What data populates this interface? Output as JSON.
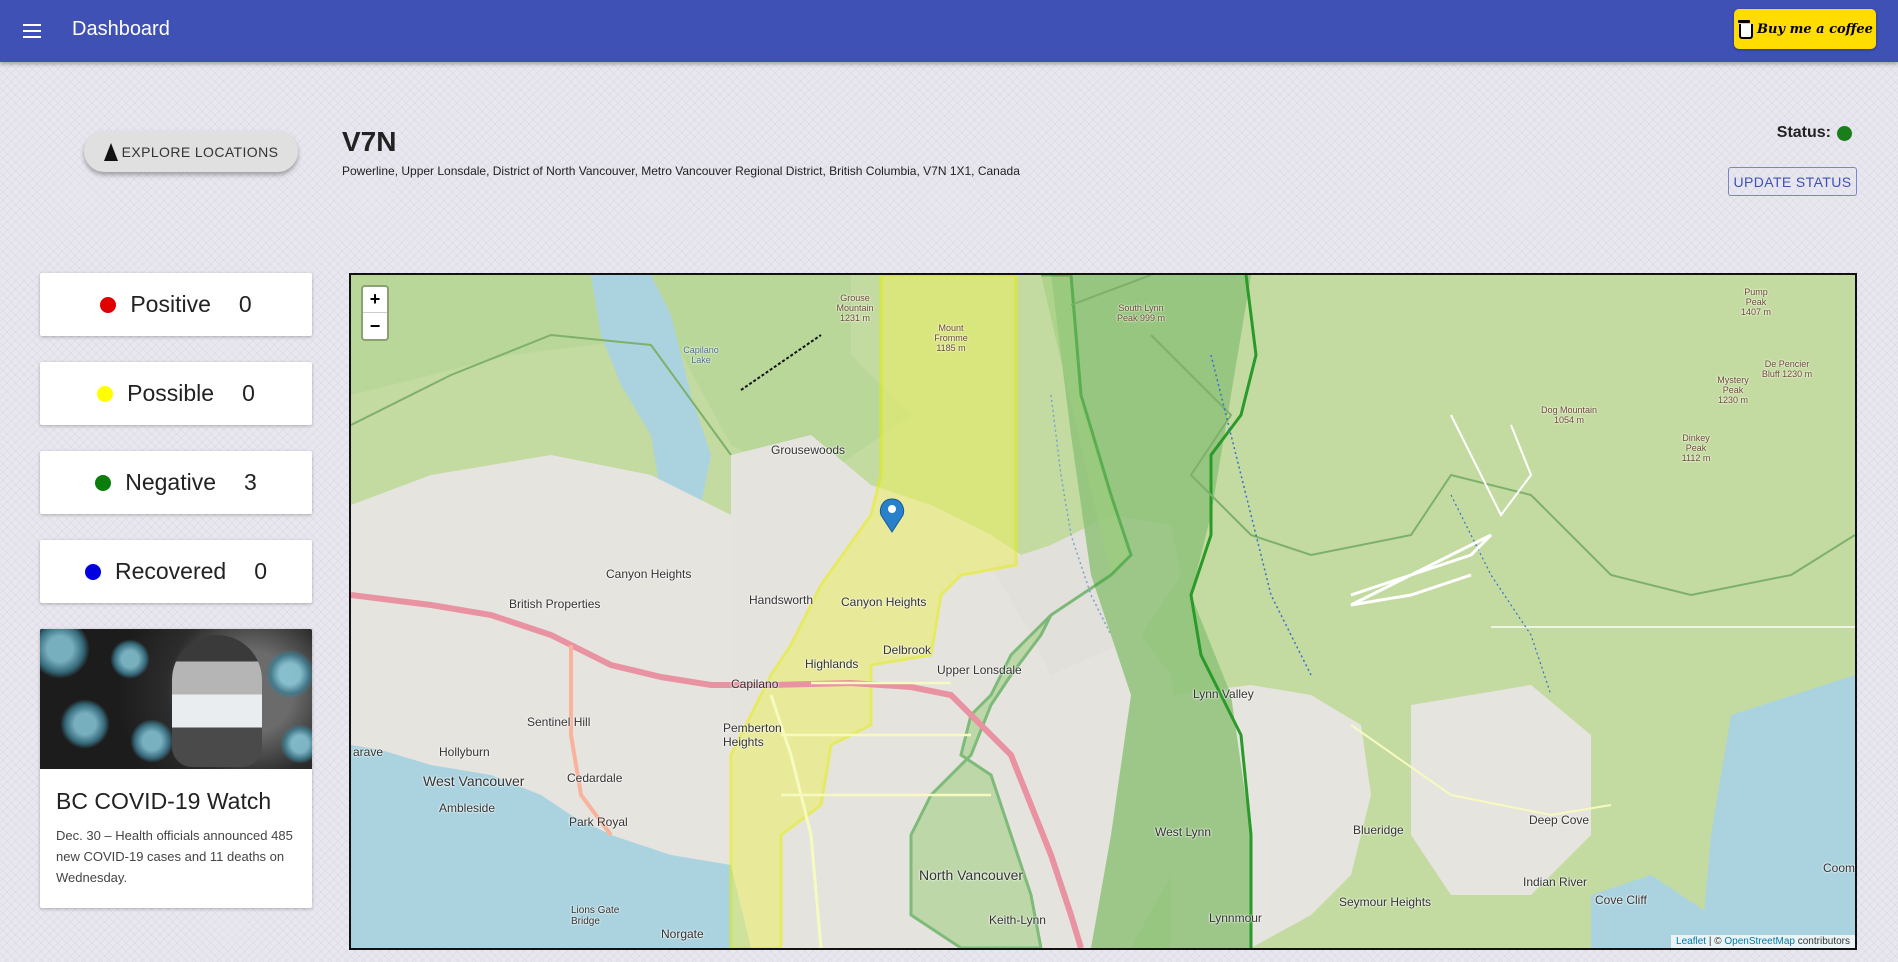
{
  "appbar": {
    "title": "Dashboard",
    "coffee_label": "Buy me a coffee"
  },
  "explore_label": "EXPLORE LOCATIONS",
  "location": {
    "postal": "V7N",
    "address": "Powerline, Upper Lonsdale, District of North Vancouver, Metro Vancouver Regional District, British Columbia, V7N 1X1, Canada"
  },
  "status": {
    "label": "Status:",
    "color": "#1a7f1a",
    "update_label": "UPDATE STATUS"
  },
  "stats": [
    {
      "label": "Positive",
      "count": "0",
      "color": "#e00000"
    },
    {
      "label": "Possible",
      "count": "0",
      "color": "#ffff00"
    },
    {
      "label": "Negative",
      "count": "3",
      "color": "#0a7d0a"
    },
    {
      "label": "Recovered",
      "count": "0",
      "color": "#0000e0"
    }
  ],
  "news": {
    "title": "BC COVID-19 Watch",
    "text": "Dec. 30 – Health officials announced 485 new COVID-19 cases and 11 deaths on Wednesday."
  },
  "map": {
    "zoom_in": "+",
    "zoom_out": "−",
    "attribution_leaflet": "Leaflet",
    "attribution_sep": " | © ",
    "attribution_osm": "OpenStreetMap",
    "attribution_tail": " contributors",
    "labels": {
      "grouse_mountain": "Grouse Mountain 1231 m",
      "mount_fromme": "Mount Fromme 1185 m",
      "south_lynn_peak": "South Lynn Peak 999 m",
      "pump_peak": "Pump Peak 1407 m",
      "depencier_bluff": "De Pencier Bluff 1230 m",
      "mystery_peak": "Mystery Peak 1230 m",
      "dinkey_peak": "Dinkey Peak 1112 m",
      "dog_mountain": "Dog Mountain 1054 m",
      "capilano_lake": "Capilano Lake",
      "grousewoods": "Grousewoods",
      "canyon_heights_w": "Canyon Heights",
      "british_properties": "British Properties",
      "handsworth": "Handsworth",
      "canyon_heights": "Canyon Heights",
      "highlands": "Highlands",
      "delbrook": "Delbrook",
      "upper_lonsdale": "Upper Lonsdale",
      "capilano": "Capilano",
      "sentinel_hill": "Sentinel Hill",
      "hollyburn": "Hollyburn",
      "west_vancouver": "West Vancouver",
      "cedardale": "Cedardale",
      "pemberton_heights": "Pemberton Heights",
      "ambleside": "Ambleside",
      "park_royal": "Park Royal",
      "north_vancouver": "North Vancouver",
      "lynn_valley": "Lynn Valley",
      "west_lynn": "West Lynn",
      "blueridge": "Blueridge",
      "deep_cove": "Deep Cove",
      "indian_river": "Indian River",
      "cove_cliff": "Cove Cliff",
      "seymour_heights": "Seymour Heights",
      "lynnmour": "Lynnmour",
      "keith_lynn": "Keith-Lynn",
      "norgate": "Norgate",
      "lions_gate": "Lions Gate Bridge",
      "caulfeild": "arave",
      "coomb": "Coomb"
    }
  }
}
